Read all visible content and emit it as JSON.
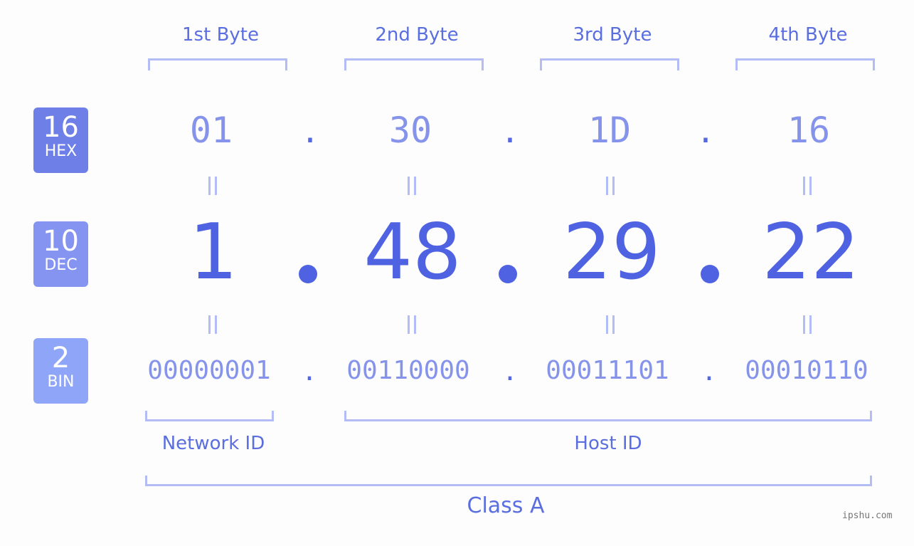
{
  "bytes": [
    {
      "label": "1st Byte",
      "hex": "01",
      "dec": "1",
      "bin": "00000001"
    },
    {
      "label": "2nd Byte",
      "hex": "30",
      "dec": "48",
      "bin": "00110000"
    },
    {
      "label": "3rd Byte",
      "hex": "1D",
      "dec": "29",
      "bin": "00011101"
    },
    {
      "label": "4th Byte",
      "hex": "16",
      "dec": "22",
      "bin": "00010110"
    }
  ],
  "separator": ".",
  "badges": {
    "hex": {
      "number": "16",
      "label": "HEX",
      "color": "#6f7fe8"
    },
    "dec": {
      "number": "10",
      "label": "DEC",
      "color": "#8594f0"
    },
    "bin": {
      "number": "2",
      "label": "BIN",
      "color": "#8fa6f8"
    }
  },
  "parts": {
    "network": "Network ID",
    "host": "Host ID",
    "class": "Class A"
  },
  "watermark": "ipshu.com",
  "colors": {
    "accent": "#4f63e2",
    "light": "#8593eb",
    "bracket": "#b3bcf5"
  }
}
